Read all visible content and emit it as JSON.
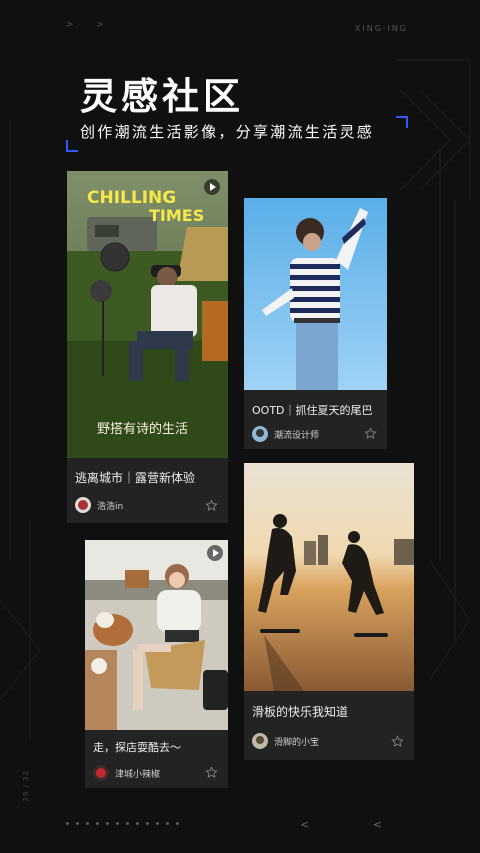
{
  "header": {
    "arrows_top": "> >",
    "brand": "XING·ING",
    "title": "灵感社区",
    "subtitle": "创作潮流生活影像，分享潮流生活灵感"
  },
  "colors": {
    "background": "#101010",
    "accent_bracket": "#2f58ff",
    "card_bg": "#232323"
  },
  "cards": [
    {
      "title": "逃离城市｜露营新体验",
      "author": "浩浩in",
      "photo_text_top": "CHILLING",
      "photo_text_bottom": "TIMES",
      "photo_caption": "野搭有诗的生活",
      "icon": "star-icon",
      "has_play": true
    },
    {
      "title": "OOTD｜抓住夏天的尾巴",
      "author": "潮流设计师",
      "icon": "star-icon",
      "has_play": false
    },
    {
      "title": "走，探店耍酷去～",
      "author": "津城小辣椒",
      "icon": "star-icon",
      "has_play": true
    },
    {
      "title": "滑板的快乐我知道",
      "author": "滑脚的小宝",
      "icon": "star-icon",
      "has_play": false
    }
  ],
  "footer": {
    "page_counter": "28 / 32",
    "arrows_bottom": "< <"
  }
}
